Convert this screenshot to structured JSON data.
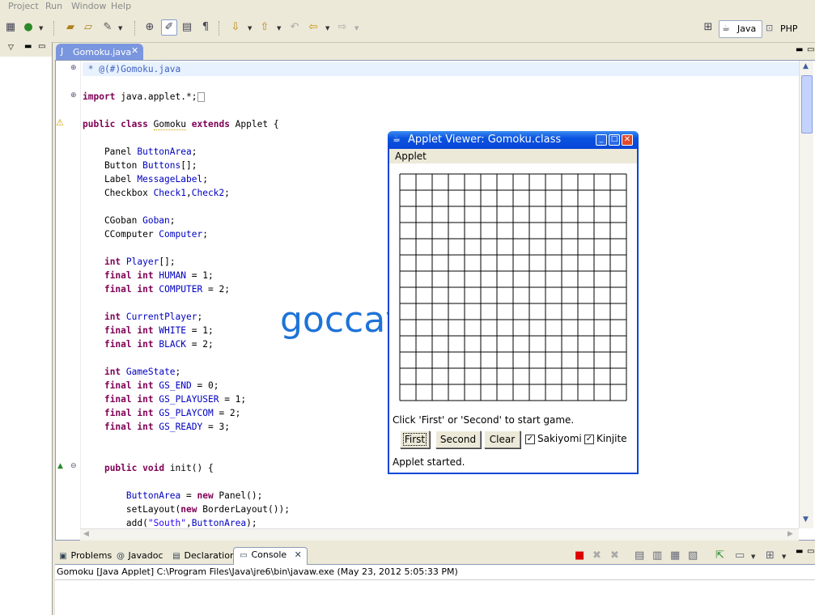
{
  "menu": [
    "Project",
    "Run",
    "Window",
    "Help"
  ],
  "perspectives": {
    "java": "Java",
    "php": "PHP"
  },
  "editor": {
    "tab_label": "Gomoku.java",
    "lines": [
      {
        "t": "comment",
        "text": " * @(#)Gomoku.java"
      },
      {
        "t": "blank"
      },
      {
        "t": "import",
        "kw": "import",
        "rest": " java.applet.*;"
      },
      {
        "t": "blank"
      },
      {
        "t": "classdecl",
        "kw1": "public",
        "kw2": "class",
        "name": "Gomoku",
        "kw3": "extends",
        "rest": "Applet {"
      },
      {
        "t": "blank"
      },
      {
        "t": "decl",
        "indent": 4,
        "type": "Panel",
        "field": "ButtonArea",
        "suffix": ";"
      },
      {
        "t": "decl",
        "indent": 4,
        "type": "Button",
        "field": "Buttons",
        "suffix": "[];"
      },
      {
        "t": "decl",
        "indent": 4,
        "type": "Label",
        "field": "MessageLabel",
        "suffix": ";"
      },
      {
        "t": "decl",
        "indent": 4,
        "type": "Checkbox",
        "field": "Check1",
        "suffix": ",",
        "field2": "Check2",
        "suffix2": ";"
      },
      {
        "t": "blank"
      },
      {
        "t": "decl",
        "indent": 4,
        "type": "CGoban",
        "field": "Goban",
        "suffix": ";"
      },
      {
        "t": "decl",
        "indent": 4,
        "type": "CComputer",
        "field": "Computer",
        "suffix": ";"
      },
      {
        "t": "blank"
      },
      {
        "t": "kwdecl",
        "indent": 4,
        "kws": "int",
        "field": "Player",
        "suffix": "[];"
      },
      {
        "t": "kwdecl",
        "indent": 4,
        "kws": "final int",
        "field": "HUMAN",
        "suffix": " = 1;"
      },
      {
        "t": "kwdecl",
        "indent": 4,
        "kws": "final int",
        "field": "COMPUTER",
        "suffix": " = 2;"
      },
      {
        "t": "blank"
      },
      {
        "t": "kwdecl",
        "indent": 4,
        "kws": "int",
        "field": "CurrentPlayer",
        "suffix": ";"
      },
      {
        "t": "kwdecl",
        "indent": 4,
        "kws": "final int",
        "field": "WHITE",
        "suffix": " = 1;"
      },
      {
        "t": "kwdecl",
        "indent": 4,
        "kws": "final int",
        "field": "BLACK",
        "suffix": " = 2;"
      },
      {
        "t": "blank"
      },
      {
        "t": "kwdecl",
        "indent": 4,
        "kws": "int",
        "field": "GameState",
        "suffix": ";"
      },
      {
        "t": "kwdecl",
        "indent": 4,
        "kws": "final int",
        "field": "GS_END",
        "suffix": " = 0;"
      },
      {
        "t": "kwdecl",
        "indent": 4,
        "kws": "final int",
        "field": "GS_PLAYUSER",
        "suffix": " = 1;"
      },
      {
        "t": "kwdecl",
        "indent": 4,
        "kws": "final int",
        "field": "GS_PLAYCOM",
        "suffix": " = 2;"
      },
      {
        "t": "kwdecl",
        "indent": 4,
        "kws": "final int",
        "field": "GS_READY",
        "suffix": " = 3;"
      },
      {
        "t": "blank"
      },
      {
        "t": "blank"
      },
      {
        "t": "method",
        "indent": 4,
        "kws": "public void",
        "rest": " init() {"
      },
      {
        "t": "blank"
      },
      {
        "t": "assign",
        "indent": 8,
        "field": "ButtonArea",
        "mid": " = ",
        "kw": "new",
        "rest": " Panel();"
      },
      {
        "t": "plain",
        "indent": 8,
        "pre": "setLayout(",
        "kw": "new",
        "rest": " BorderLayout());"
      },
      {
        "t": "addcall",
        "indent": 8,
        "pre": "add(",
        "str": "\"South\"",
        "mid": ",",
        "field": "ButtonArea",
        "rest": ");"
      }
    ]
  },
  "watermark": "goccay.vn",
  "applet": {
    "title": "Applet Viewer: Gomoku.class",
    "menu": "Applet",
    "board_size": 14,
    "message": "Click 'First' or 'Second' to start game.",
    "buttons": [
      "First",
      "Second",
      "Clear"
    ],
    "checkboxes": [
      {
        "label": "Sakiyomi",
        "checked": true
      },
      {
        "label": "Kinjite",
        "checked": true
      }
    ],
    "status": "Applet started."
  },
  "console": {
    "tabs": [
      {
        "label": "Problems",
        "icon": "problems-icon"
      },
      {
        "label": "Javadoc",
        "icon": "javadoc-icon"
      },
      {
        "label": "Declaration",
        "icon": "declaration-icon"
      },
      {
        "label": "Console",
        "icon": "console-icon",
        "active": true
      }
    ],
    "status": "Gomoku [Java Applet] C:\\Program Files\\Java\\jre6\\bin\\javaw.exe (May 23, 2012 5:05:33 PM)"
  }
}
